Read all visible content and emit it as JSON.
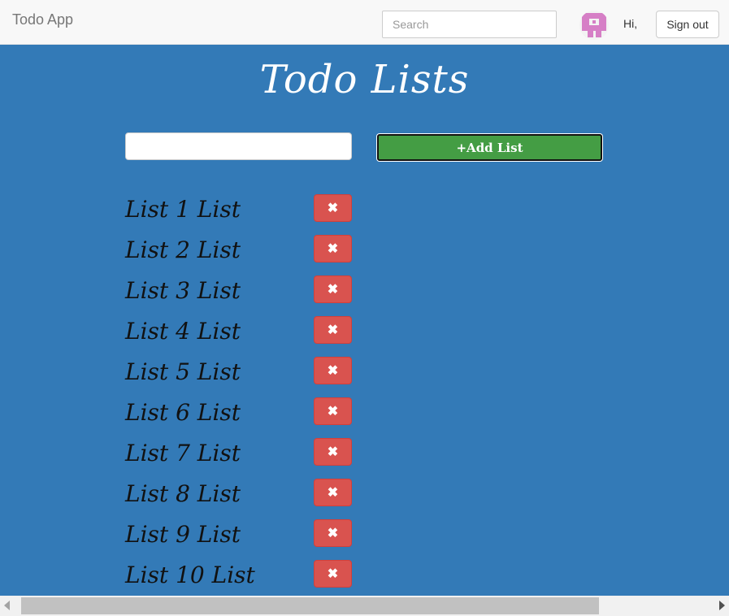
{
  "navbar": {
    "brand": "Todo App",
    "search_placeholder": "Search",
    "greeting": "Hi,",
    "signout_label": "Sign out"
  },
  "page": {
    "title": "Todo Lists",
    "new_list_value": "",
    "add_label": "+Add List"
  },
  "lists": [
    {
      "name": "List 1 List"
    },
    {
      "name": "List 2 List"
    },
    {
      "name": "List 3 List"
    },
    {
      "name": "List 4 List"
    },
    {
      "name": "List 5 List"
    },
    {
      "name": "List 6 List"
    },
    {
      "name": "List 7 List"
    },
    {
      "name": "List 8 List"
    },
    {
      "name": "List 9 List"
    },
    {
      "name": "List 10 List"
    }
  ],
  "delete_glyph": "✖",
  "icons": {
    "avatar": "identicon-avatar",
    "delete": "close-icon",
    "scroll_left": "chevron-left-icon",
    "scroll_right": "chevron-right-icon"
  },
  "colors": {
    "background": "#337ab7",
    "navbar": "#f8f8f8",
    "add_button": "#449d44",
    "delete_button": "#d9534f",
    "avatar": "#d67fc6"
  }
}
